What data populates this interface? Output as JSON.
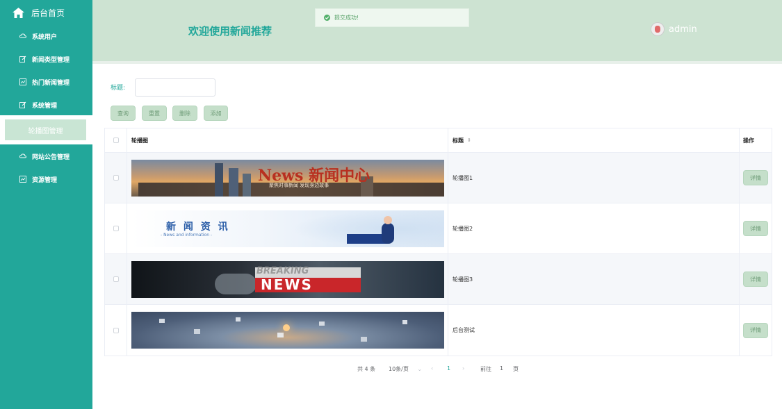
{
  "sidebar": {
    "home_label": "后台首页",
    "items": [
      {
        "label": "系统用户",
        "icon": "cloud-icon"
      },
      {
        "label": "新闻类型管理",
        "icon": "edit-icon"
      },
      {
        "label": "热门新闻管理",
        "icon": "chart-icon"
      },
      {
        "label": "系统管理",
        "icon": "edit-icon"
      },
      {
        "label": "轮播图管理",
        "icon": "none"
      },
      {
        "label": "网站公告管理",
        "icon": "cloud-icon"
      },
      {
        "label": "资源管理",
        "icon": "chart-icon"
      }
    ]
  },
  "header": {
    "welcome": "欢迎使用新闻推荐",
    "username": "admin"
  },
  "toast": {
    "message": "提交成功!"
  },
  "search": {
    "label": "标题:",
    "value": ""
  },
  "toolbar": {
    "query": "查询",
    "reset": "重置",
    "delete": "删除",
    "add": "添加"
  },
  "table": {
    "columns": [
      "轮播图",
      "标题",
      "操作"
    ],
    "rows": [
      {
        "title": "轮播图1",
        "image_text": "News 新闻中心",
        "image_sub": "聚焦时事新闻  发现身边故事",
        "action": "详情"
      },
      {
        "title": "轮播图2",
        "image_text": "新 闻 资 讯",
        "image_sub": "- News and information -",
        "action": "详情"
      },
      {
        "title": "轮播图3",
        "image_text": "BREAKING",
        "image_sub": "NEWS",
        "action": "详情"
      },
      {
        "title": "后台测试",
        "image_text": "",
        "image_sub": "",
        "action": "详情"
      }
    ]
  },
  "pagination": {
    "total": "共 4 条",
    "page_size": "10条/页",
    "current_page": "1",
    "goto_label": "前往",
    "goto_value": "1",
    "page_suffix": "页"
  },
  "colors": {
    "sidebar": "#22a79a",
    "header": "#cde3d2",
    "accent": "#22a79a",
    "button": "#c5dfca"
  }
}
